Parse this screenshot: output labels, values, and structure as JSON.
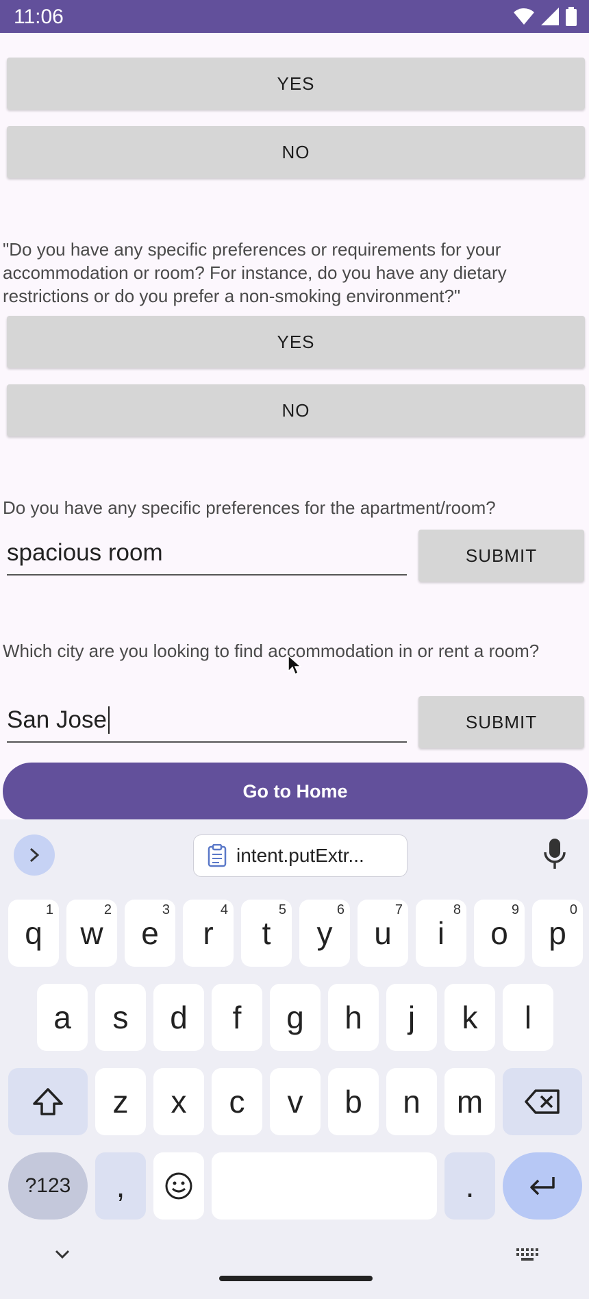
{
  "status_bar": {
    "time": "11:06"
  },
  "prev_block": {
    "yes_label": "YES",
    "no_label": "NO"
  },
  "question1": {
    "text": "\"Do you have any specific preferences or requirements for your accommodation or room? For instance, do you have any dietary restrictions or do you prefer a non-smoking environment?\"",
    "yes_label": "YES",
    "no_label": "NO"
  },
  "question2": {
    "text": "Do you have any specific preferences for the apartment/room?",
    "input_value": "spacious room",
    "submit_label": "SUBMIT"
  },
  "question3": {
    "text": "Which city are you looking to find accommodation in or rent a room?",
    "input_value": "San Jose",
    "submit_label": "SUBMIT"
  },
  "home_button": {
    "label": "Go to Home"
  },
  "keyboard": {
    "clipboard_suggestion": "intent.putExtr...",
    "row1": [
      {
        "key": "q",
        "hint": "1"
      },
      {
        "key": "w",
        "hint": "2"
      },
      {
        "key": "e",
        "hint": "3"
      },
      {
        "key": "r",
        "hint": "4"
      },
      {
        "key": "t",
        "hint": "5"
      },
      {
        "key": "y",
        "hint": "6"
      },
      {
        "key": "u",
        "hint": "7"
      },
      {
        "key": "i",
        "hint": "8"
      },
      {
        "key": "o",
        "hint": "9"
      },
      {
        "key": "p",
        "hint": "0"
      }
    ],
    "row2": [
      "a",
      "s",
      "d",
      "f",
      "g",
      "h",
      "j",
      "k",
      "l"
    ],
    "row3": [
      "z",
      "x",
      "c",
      "v",
      "b",
      "n",
      "m"
    ],
    "symbols_label": "?123",
    "comma_label": ",",
    "period_label": "."
  },
  "colors": {
    "accent": "#62509b",
    "button_gray": "#d6d6d6",
    "enter_key": "#b7c8f5"
  }
}
